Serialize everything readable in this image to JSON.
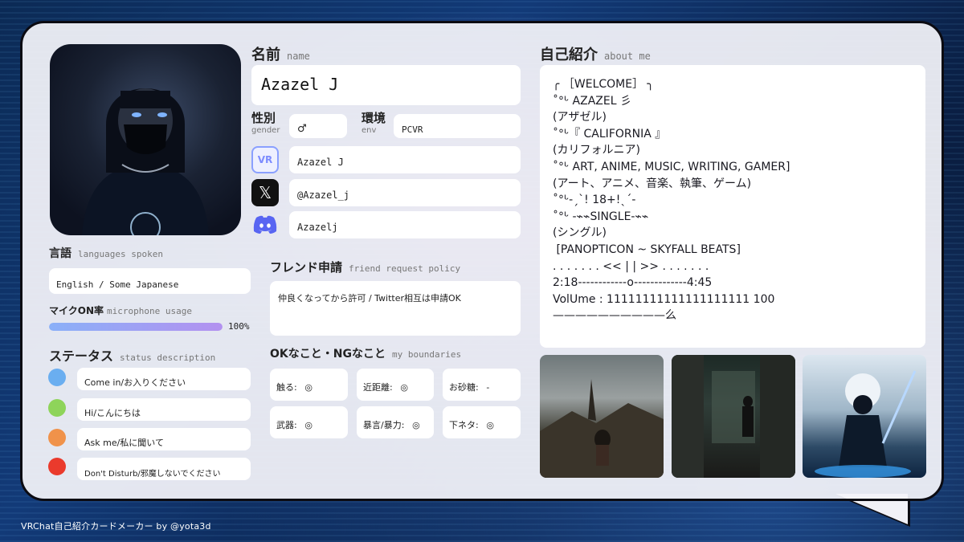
{
  "footer": "VRChat自己紹介カードメーカー by @yota3d",
  "name_section": {
    "title": "名前",
    "subtitle": "name",
    "value": "Azazel J"
  },
  "gender": {
    "label": "性別",
    "sublabel": "gender",
    "value": "♂"
  },
  "env": {
    "label": "環境",
    "sublabel": "env",
    "value": "PCVR"
  },
  "socials": [
    {
      "icon": "vrchat-icon",
      "icon_text": "VR",
      "value": "Azazel J"
    },
    {
      "icon": "x-icon",
      "icon_text": "𝕏",
      "value": "@Azazel_j"
    },
    {
      "icon": "discord-icon",
      "icon_text": "",
      "value": "Azazelj"
    }
  ],
  "languages": {
    "title": "言語",
    "subtitle": "languages spoken",
    "value": "English / Some Japanese"
  },
  "mic": {
    "title": "マイクON率",
    "subtitle": "microphone usage",
    "value": 100,
    "value_text": "100%"
  },
  "status": {
    "title": "ステータス",
    "subtitle": "status description",
    "items": [
      {
        "color": "#6aaef0",
        "text": "Come in/お入りください"
      },
      {
        "color": "#8ed45a",
        "text": "Hi/こんにちは"
      },
      {
        "color": "#f0924a",
        "text": "Ask me/私に聞いて"
      },
      {
        "color": "#ea3a2c",
        "text": "Don't Disturb/邪魔しないでください"
      }
    ]
  },
  "friend": {
    "title": "フレンド申請",
    "subtitle": "friend request policy",
    "value": "仲良くなってから許可 / Twitter相互は申請OK"
  },
  "boundaries": {
    "title": "OKなこと・NGなこと",
    "subtitle": "my boundaries",
    "items": [
      {
        "label": "触る:",
        "value": "◎"
      },
      {
        "label": "近距離:",
        "value": "◎"
      },
      {
        "label": "お砂糖:",
        "value": "-"
      },
      {
        "label": "武器:",
        "value": "◎"
      },
      {
        "label": "暴言/暴力:",
        "value": "◎"
      },
      {
        "label": "下ネタ:",
        "value": "◎"
      }
    ]
  },
  "about": {
    "title": "自己紹介",
    "subtitle": "about me",
    "lines": [
      "╭ ［WELCOME］ ╮",
      "˚°ᒡ AZAZEL 彡",
      "(アザゼル)",
      "˚°ᒡ『 CALIFORNIA 』",
      "(カリフォルニア)",
      "˚°ᒡ ART, ANIME, MUSIC, WRITING, GAMER]",
      "(アート、アニメ、音楽、執筆、ゲーム)",
      "˚°ᒡ-ˏˋ! 18+!ˎˊ-",
      "˚°ᒡ -⌁⌁SINGLE-⌁⌁",
      "(シングル)",
      "",
      " [PANOPTICON ~ SKYFALL BEATS]",
      ". . . . . . . << | | >> . . . . . . .",
      "2:18------------o-------------4:45",
      "VolUme : 11111111111111111111 100",
      "——————————么"
    ]
  }
}
